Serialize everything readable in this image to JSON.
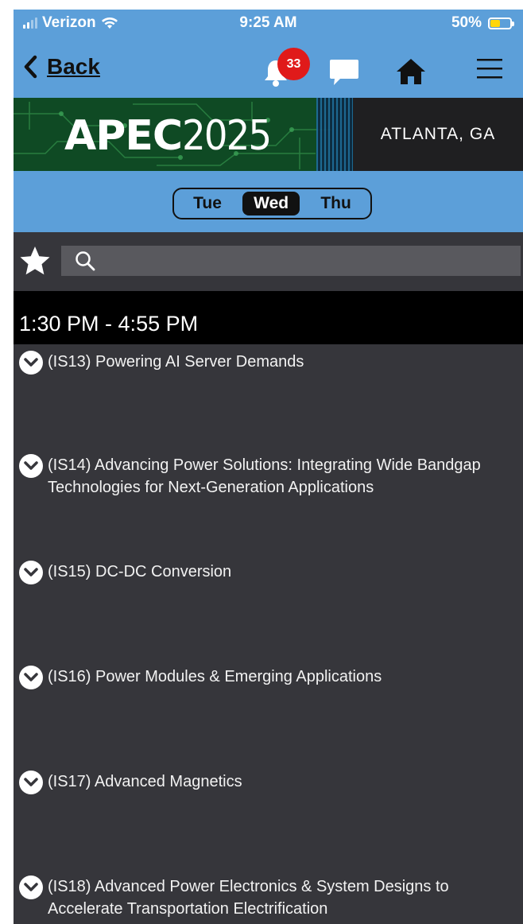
{
  "status_bar": {
    "carrier": "Verizon",
    "time": "9:25 AM",
    "battery": "50%",
    "battery_level": 0.5,
    "battery_color": "#ffd60a"
  },
  "nav": {
    "back_label": "Back",
    "notification_count": "33",
    "icons": [
      "bell-icon",
      "chat-icon",
      "home-icon",
      "menu-icon"
    ]
  },
  "banner": {
    "logo_text": "APEC",
    "logo_year": "2025",
    "location": "ATLANTA, GA"
  },
  "day_tabs": {
    "items": [
      "Tue",
      "Wed",
      "Thu"
    ],
    "selected": "Wed"
  },
  "search": {
    "value": ""
  },
  "schedule": {
    "time_range": "1:30 PM - 4:55 PM",
    "sessions": [
      {
        "title": "(IS13) Powering AI Server Demands"
      },
      {
        "title": "(IS14) Advancing Power Solutions: Integrating Wide Bandgap Technologies for Next-Generation Applications"
      },
      {
        "title": "(IS15) DC-DC Conversion"
      },
      {
        "title": "(IS16) Power Modules & Emerging Applications"
      },
      {
        "title": "(IS17) Advanced Magnetics"
      },
      {
        "title": "(IS18) Advanced Power Electronics & System Designs to Accelerate Transportation Electrification"
      }
    ]
  },
  "colors": {
    "header_blue": "#5c9fd9",
    "list_background": "#36363b",
    "badge_red": "#e01a1a"
  }
}
